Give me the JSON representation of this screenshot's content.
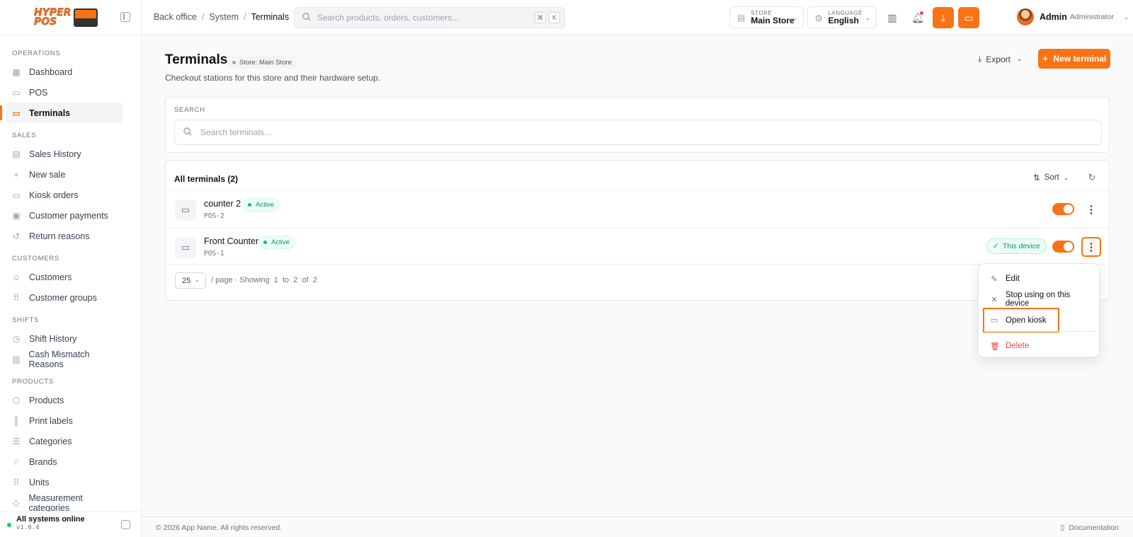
{
  "brand": {
    "logo_text_1": "HYPER",
    "logo_text_2": "POS"
  },
  "sidebar": {
    "sections": [
      {
        "title": "OPERATIONS",
        "items": [
          {
            "label": "Dashboard",
            "icon": "dashboard-icon"
          },
          {
            "label": "POS",
            "icon": "pos-icon"
          },
          {
            "label": "Terminals",
            "icon": "terminal-icon",
            "active": true
          }
        ]
      },
      {
        "title": "SALES",
        "items": [
          {
            "label": "Sales History",
            "icon": "document-icon"
          },
          {
            "label": "New sale",
            "icon": "plus-icon"
          },
          {
            "label": "Kiosk orders",
            "icon": "kiosk-icon"
          },
          {
            "label": "Customer payments",
            "icon": "cash-icon"
          },
          {
            "label": "Return reasons",
            "icon": "undo-icon"
          }
        ]
      },
      {
        "title": "CUSTOMERS",
        "items": [
          {
            "label": "Customers",
            "icon": "users-icon"
          },
          {
            "label": "Customer groups",
            "icon": "grid-dots-icon"
          }
        ]
      },
      {
        "title": "SHIFTS",
        "items": [
          {
            "label": "Shift History",
            "icon": "clock-icon"
          },
          {
            "label": "Cash Mismatch Reasons",
            "icon": "bar-chart-icon"
          }
        ]
      },
      {
        "title": "PRODUCTS",
        "items": [
          {
            "label": "Products",
            "icon": "box-icon"
          },
          {
            "label": "Print labels",
            "icon": "barcode-icon"
          },
          {
            "label": "Categories",
            "icon": "list-tree-icon"
          },
          {
            "label": "Brands",
            "icon": "star-icon"
          },
          {
            "label": "Units",
            "icon": "grid-dots-icon"
          },
          {
            "label": "Measurement categories",
            "icon": "tag-icon"
          }
        ]
      }
    ],
    "status": {
      "title": "All systems online",
      "version": "v1.0.4"
    }
  },
  "header": {
    "breadcrumb": [
      "Back office",
      "System",
      "Terminals"
    ],
    "search_placeholder": "Search products, orders, customers...",
    "kbd": [
      "⌘",
      "K"
    ],
    "store": {
      "label": "STORE",
      "value": "Main Store"
    },
    "language": {
      "label": "LANGUAGE",
      "value": "English"
    },
    "user": {
      "name": "Admin",
      "role": "Administrator"
    }
  },
  "page": {
    "title": "Terminals",
    "store_badge": "Store: Main Store",
    "subtitle": "Checkout stations for this store and their hardware setup.",
    "export_label": "Export",
    "new_label": "New terminal"
  },
  "search_card": {
    "label": "SEARCH",
    "placeholder": "Search terminals..."
  },
  "list": {
    "heading": "All terminals (2)",
    "sort_label": "Sort",
    "rows": [
      {
        "name": "counter 2",
        "code": "POS-2",
        "status": "Active",
        "enabled": true
      },
      {
        "name": "Front Counter",
        "code": "POS-1",
        "status": "Active",
        "enabled": true,
        "device_badge": "This device"
      }
    ],
    "pager": {
      "per_page": "25",
      "per_page_suffix": "/ page",
      "showing": "· Showing  1  to  2  of  2"
    }
  },
  "menu": {
    "items": [
      {
        "label": "Edit",
        "icon": "edit-icon"
      },
      {
        "label": "Stop using on this device",
        "icon": "close-icon"
      },
      {
        "label": "Open kiosk",
        "icon": "kiosk-icon"
      },
      {
        "label": "Delete",
        "icon": "trash-icon"
      }
    ]
  },
  "footer": {
    "copyright": "© 2026 App Name. All rights reserved.",
    "docs": "Documentation"
  },
  "colors": {
    "accent": "#f97316",
    "success": "#059669",
    "danger": "#ef4444"
  }
}
